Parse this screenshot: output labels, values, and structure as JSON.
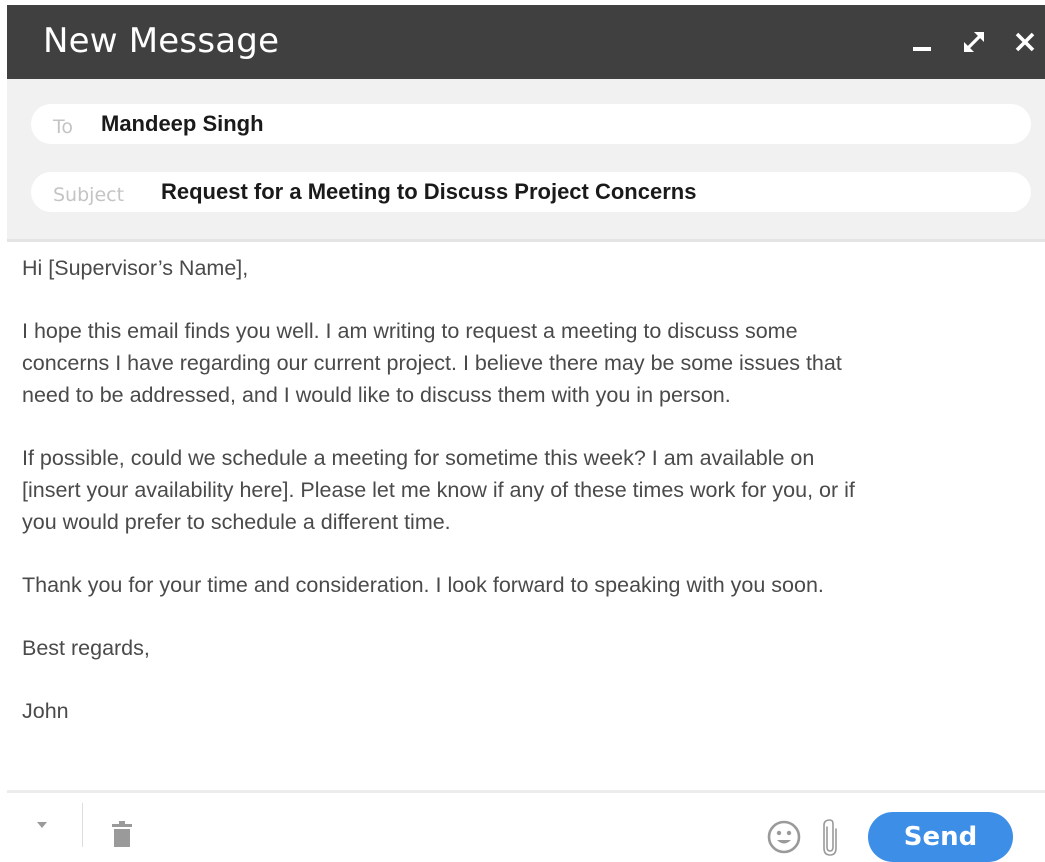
{
  "window": {
    "title": "New Message",
    "icons": {
      "minimize": "minimize-icon",
      "maximize": "expand-icon",
      "close": "close-icon"
    }
  },
  "compose": {
    "to_label": "To",
    "to_value": "Mandeep Singh",
    "subject_label": "Subject",
    "subject_value": "Request for a Meeting to Discuss Project Concerns"
  },
  "body": {
    "greeting": "Hi [Supervisor’s Name],",
    "paragraph1": [
      "I hope this email finds you well. I am writing to request a meeting to discuss some",
      "concerns I have regarding our current project. I believe there may be some issues that",
      "need to be addressed, and I would like to discuss them with you in person."
    ],
    "paragraph2": [
      "If possible, could we schedule a meeting for sometime this week? I am available on",
      "[insert your availability here]. Please let me know if any of these times work for you, or if",
      "you would prefer to schedule a different time."
    ],
    "paragraph3": "Thank you for your time and consideration. I look forward to speaking with you soon.",
    "closing": "Best regards,",
    "signature": "John"
  },
  "footer": {
    "send_label": "Send",
    "icons": {
      "more": "caret-down-icon",
      "delete": "trash-icon",
      "emoji": "smiley-icon",
      "attach": "paperclip-icon"
    }
  },
  "colors": {
    "header_bg": "#404040",
    "fields_bg": "#f1f1f1",
    "send_button": "#3d8ee6"
  }
}
